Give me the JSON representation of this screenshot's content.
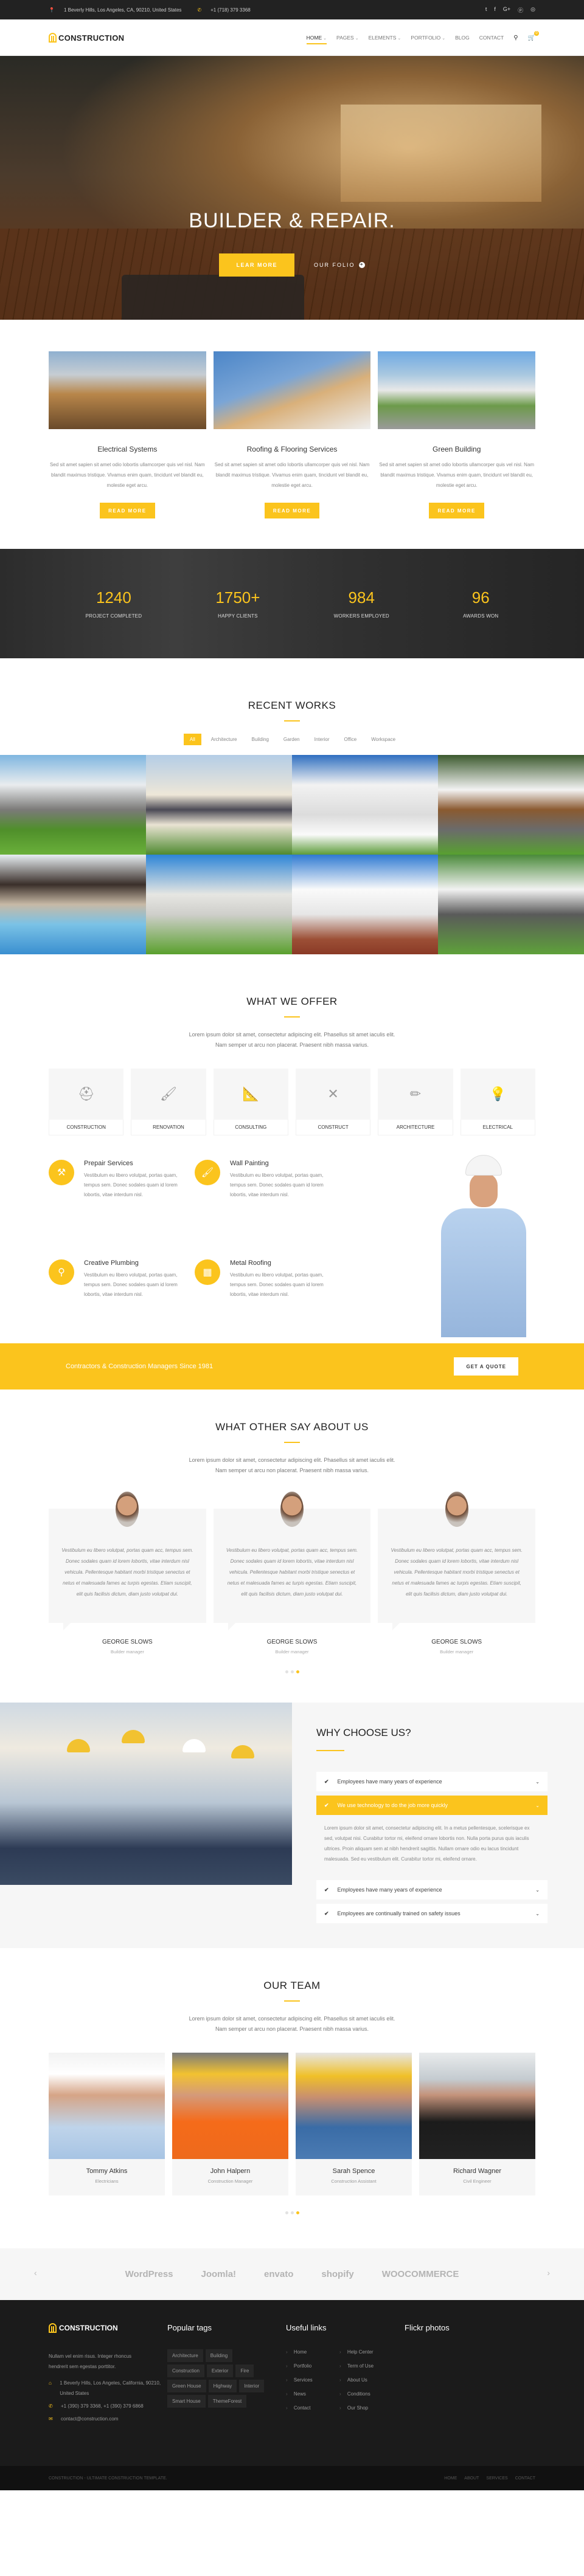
{
  "topbar": {
    "address": "1 Beverly Hills, Los Angeles, CA, 90210, United States",
    "phone": "+1 (718) 379 3368",
    "social": [
      "twitter-icon",
      "facebook-icon",
      "google-plus-icon",
      "pinterest-icon",
      "dribbble-icon"
    ]
  },
  "header": {
    "brand": "CONSTRUCTION",
    "nav": [
      {
        "label": "HOME",
        "caret": "⌄",
        "active": true
      },
      {
        "label": "PAGES",
        "caret": "⌄"
      },
      {
        "label": "ELEMENTS",
        "caret": "⌄"
      },
      {
        "label": "PORTFOLIO",
        "caret": "⌄"
      },
      {
        "label": "BLOG"
      },
      {
        "label": "CONTACT"
      }
    ],
    "cart_count": "0"
  },
  "hero": {
    "title": "BUILDER & REPAIR.",
    "primary_button": "LEAR MORE",
    "secondary_button": "OUR FOLIO"
  },
  "services": [
    {
      "title": "Electrical Systems",
      "text": "Sed sit amet sapien sit amet odio lobortis ullamcorper quis vel nisl. Nam blandit maximus tristique. Vivamus enim quam, tincidunt vel blandit eu, molestie eget arcu.",
      "button": "READ MORE"
    },
    {
      "title": "Roofing & Flooring Services",
      "text": "Sed sit amet sapien sit amet odio lobortis ullamcorper quis vel nisl. Nam blandit maximus tristique. Vivamus enim quam, tincidunt vel blandit eu, molestie eget arcu.",
      "button": "READ MORE"
    },
    {
      "title": "Green Building",
      "text": "Sed sit amet sapien sit amet odio lobortis ullamcorper quis vel nisl. Nam blandit maximus tristique. Vivamus enim quam, tincidunt vel blandit eu, molestie eget arcu.",
      "button": "READ MORE"
    }
  ],
  "stats": [
    {
      "value": "1240",
      "label": "PROJECT COMPLETED"
    },
    {
      "value": "1750+",
      "label": "HAPPY CLIENTS"
    },
    {
      "value": "984",
      "label": "WORKERS EMPLOYED"
    },
    {
      "value": "96",
      "label": "AWARDS WON"
    }
  ],
  "works": {
    "title": "RECENT WORKS",
    "filters": [
      "All",
      "Architecture",
      "Building",
      "Garden",
      "Interior",
      "Office",
      "Workspace"
    ],
    "active_filter": "All"
  },
  "offer": {
    "title": "WHAT WE OFFER",
    "intro": "Lorem ipsum dolor sit amet, consectetur adipiscing elit. Phasellus sit amet iaculis elit. Nam semper ut arcu non placerat. Praesent nibh massa varius.",
    "categories": [
      {
        "label": "CONSTRUCTION",
        "icon": "hard-hat-icon"
      },
      {
        "label": "RENOVATION",
        "icon": "paint-roller-icon"
      },
      {
        "label": "CONSULTING",
        "icon": "ruler-square-icon"
      },
      {
        "label": "CONSTRUCT",
        "icon": "tools-icon"
      },
      {
        "label": "ARCHITECTURE",
        "icon": "pencil-ruler-icon"
      },
      {
        "label": "ELECTRICAL",
        "icon": "lightbulb-icon"
      }
    ],
    "features": [
      {
        "title": "Prepair Services",
        "text": "Vestibulum eu libero volutpat, portas quam, tempus sem. Donec sodales quam id lorem lobortis, vitae interdum nisl.",
        "icon": "drill-icon"
      },
      {
        "title": "Wall Painting",
        "text": "Vestibulum eu libero volutpat, portas quam, tempus sem. Donec sodales quam id lorem lobortis, vitae interdum nisl.",
        "icon": "paint-roller-icon"
      },
      {
        "title": "Creative Plumbing",
        "text": "Vestibulum eu libero volutpat, portas quam, tempus sem. Donec sodales quam id lorem lobortis, vitae interdum nisl.",
        "icon": "faucet-icon"
      },
      {
        "title": "Metal Roofing",
        "text": "Vestibulum eu libero volutpat, portas quam, tempus sem. Donec sodales quam id lorem lobortis, vitae interdum nisl.",
        "icon": "roof-tiles-icon"
      }
    ]
  },
  "cta": {
    "text": "Contractors & Construction Managers Since 1981",
    "button": "GET A QUOTE"
  },
  "testimonials": {
    "title": "WHAT OTHER SAY ABOUT US",
    "intro": "Lorem ipsum dolor sit amet, consectetur adipiscing elit. Phasellus sit amet iaculis elit. Nam semper ut arcu non placerat. Praesent nibh massa varius.",
    "items": [
      {
        "quote": "Vestibulum eu libero volutpat, portas quam acc, tempus sem. Donec sodales quam id lorem lobortis, vitae interdum nisl vehicula. Pellentesque habitant morbi tristique senectus et netus et malesuada fames ac turpis egestas. Etiam suscipit, elit quis facilisis dictum, diam justo volutpat dui.",
        "name": "GEORGE SLOWS",
        "role": "Builder manager"
      },
      {
        "quote": "Vestibulum eu libero volutpat, portas quam acc, tempus sem. Donec sodales quam id lorem lobortis, vitae interdum nisl vehicula. Pellentesque habitant morbi tristique senectus et netus et malesuada fames ac turpis egestas. Etiam suscipit, elit quis facilisis dictum, diam justo volutpat dui.",
        "name": "GEORGE SLOWS",
        "role": "Builder manager"
      },
      {
        "quote": "Vestibulum eu libero volutpat, portas quam acc, tempus sem. Donec sodales quam id lorem lobortis, vitae interdum nisl vehicula. Pellentesque habitant morbi tristique senectus et netus et malesuada fames ac turpis egestas. Etiam suscipit, elit quis facilisis dictum, diam justo volutpat dui.",
        "name": "GEORGE SLOWS",
        "role": "Builder manager"
      }
    ],
    "pages": 3,
    "active_page": 3
  },
  "why": {
    "title": "WHY CHOOSE US?",
    "items": [
      {
        "label": "Employees have many years of experience",
        "open": false
      },
      {
        "label": "We use technology to do the job more quickly",
        "open": true,
        "body": "Lorem ipsum dolor sit amet, consectetur adipiscing elit. In a metus pellentesque, scelerisque ex sed, volutpat nisi. Curabitur tortor mi, eleifend ornare lobortis non. Nulla porta purus quis iaculis ultrices. Proin aliquam sem at nibh hendrerit sagittis. Nullam ornare odio eu lacus tincidunt malesuada. Sed eu vestibulum elit. Curabitur tortor mi, eleifend ornare."
      },
      {
        "label": "Employees have many years of experience",
        "open": false
      },
      {
        "label": "Employees are continually trained on safety issues",
        "open": false
      }
    ]
  },
  "team": {
    "title": "OUR TEAM",
    "intro": "Lorem ipsum dolor sit amet, consectetur adipiscing elit. Phasellus sit amet iaculis elit. Nam semper ut arcu non placerat. Praesent nibh massa varius.",
    "members": [
      {
        "name": "Tommy Atkins",
        "role": "Electricians"
      },
      {
        "name": "John Halpern",
        "role": "Construction Manager"
      },
      {
        "name": "Sarah Spence",
        "role": "Construction Assistant"
      },
      {
        "name": "Richard Wagner",
        "role": "Civil Engineer"
      }
    ],
    "pages": 3,
    "active_page": 3
  },
  "brands": [
    "WordPress",
    "Joomla!",
    "envato",
    "shopify",
    "WOOCOMMERCE"
  ],
  "footer": {
    "brand": "CONSTRUCTION",
    "about": "Nullam vel enim risus. Integer rhoncus hendrerit sem egestas porttitor.",
    "address": "1 Beverly Hills, Los Angeles, California, 90210, United States",
    "phones": "+1 (390) 379 3368, +1 (390) 379 6868",
    "email": "contact@construction.com",
    "tags_title": "Popular tags",
    "tags": [
      "Architecture",
      "Building",
      "Construction",
      "Exterior",
      "Fire",
      "Green House",
      "Highway",
      "Interior",
      "Smart House",
      "ThemeForest"
    ],
    "links_title": "Useful links",
    "links": [
      "Home",
      "Help Center",
      "Portfolio",
      "Term of Use",
      "Services",
      "About Us",
      "News",
      "Conditions",
      "Contact",
      "Our Shop"
    ],
    "flickr_title": "Flickr photos",
    "copyright": "CONSTRUCTION - ULTIMATE CONSTRUCTION TEMPLATE.",
    "bottom_links": [
      "HOME",
      "ABOUT",
      "SERVICES",
      "CONTACT"
    ]
  },
  "colors": {
    "accent": "#fbc41d",
    "dark": "#1b1b1b",
    "light": "#f6f6f6"
  }
}
